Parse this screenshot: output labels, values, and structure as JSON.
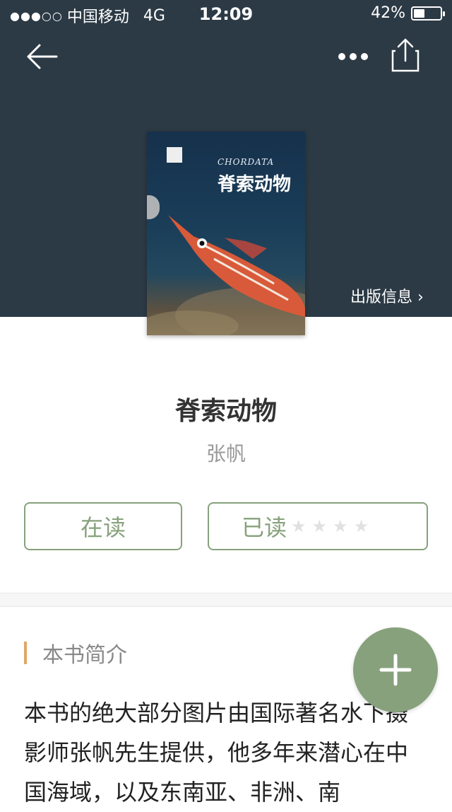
{
  "status_bar": {
    "carrier": "中国移动",
    "network": "4G",
    "time": "12:09",
    "battery": "42%",
    "battery_level": 0.42
  },
  "nav": {
    "back_icon": "arrow-left-icon",
    "more_icon": "more-horizontal-icon",
    "share_icon": "share-icon"
  },
  "cover": {
    "subtitle": "CHORDATA",
    "title": "脊索动物"
  },
  "publication_info_label": "出版信息 ›",
  "book": {
    "title": "脊索动物",
    "author": "张帆"
  },
  "actions": {
    "reading_label": "在读",
    "read_label": "已读",
    "rating_stars": 0,
    "rating_max": 4
  },
  "intro": {
    "heading": "本书简介",
    "text": "本书的绝大部分图片由国际著名水下摄影师张帆先生提供，他多年来潜心在中国海域，以及东南亚、非洲、南"
  },
  "fab": {
    "icon": "plus-icon"
  },
  "colors": {
    "header_bg": "#2c3a45",
    "accent_green": "#87a17c",
    "section_bar": "#e0a766"
  }
}
